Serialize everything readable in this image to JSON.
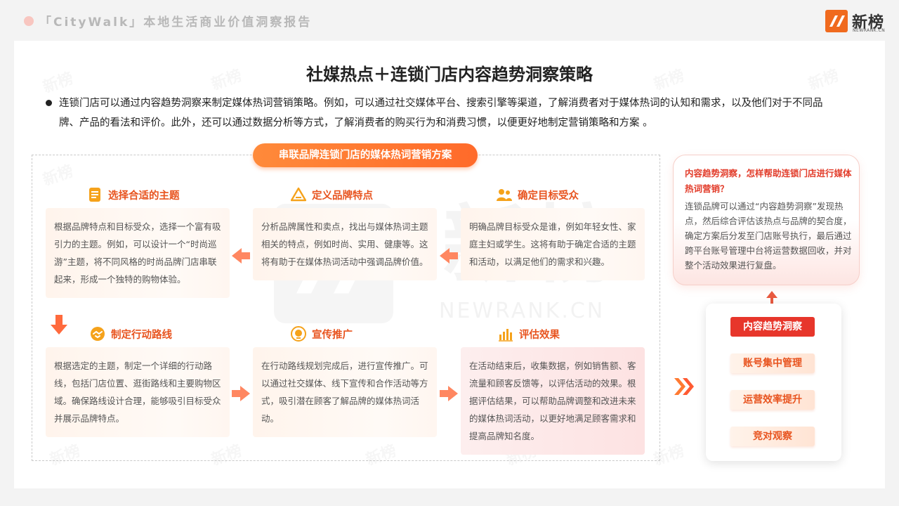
{
  "header": {
    "report_title": "「CityWalk」本地生活商业价值洞察报告",
    "logo_cn": "新榜",
    "logo_en": "NEWRANK.CN"
  },
  "watermark": {
    "cn": "新榜",
    "en": "NEWRANK.CN"
  },
  "page": {
    "title": "社媒热点＋连锁门店内容趋势洞察策略",
    "intro": "连锁门店可以通过内容趋势洞察来制定媒体热词营销策略。例如，可以通过社交媒体平台、搜索引擎等渠道，了解消费者对于媒体热词的认知和需求，以及他们对于不同品牌、产品的看法和评价。此外，还可以通过数据分析等方式，了解消费者的购买行为和消费习惯，以便更好地制定营销策略和方案 。"
  },
  "flow": {
    "title": "串联品牌连锁门店的媒体热词营销方案",
    "steps": [
      {
        "title": "选择合适的主题",
        "text": "根据品牌特点和目标受众，选择一个富有吸引力的主题。例如，可以设计一个“时尚巡游”主题，将不同风格的时尚品牌门店串联起来，形成一个独特的购物体验。"
      },
      {
        "title": "定义品牌特点",
        "text": "分析品牌属性和卖点，找出与媒体热词主题相关的特点，例如时尚、实用、健康等。这将有助于在媒体热词活动中强调品牌价值。"
      },
      {
        "title": "确定目标受众",
        "text": "明确品牌目标受众是谁，例如年轻女性、家庭主妇或学生。这将有助于确定合适的主题和活动，以满足他们的需求和兴趣。"
      },
      {
        "title": "制定行动路线",
        "text": "根据选定的主题，制定一个详细的行动路线，包括门店位置、逛街路线和主要购物区域。确保路线设计合理，能够吸引目标受众并展示品牌特点。"
      },
      {
        "title": "宣传推广",
        "text": "在行动路线规划完成后，进行宣传推广。可以通过社交媒体、线下宣传和合作活动等方式，吸引潜在顾客了解品牌的媒体热词活动。"
      },
      {
        "title": "评估效果",
        "text": "在活动结束后，收集数据，例如销售额、客流量和顾客反馈等，以评估活动的效果。根据评估结果，可以帮助品牌调整和改进未来的媒体热词活动，以更好地满足顾客需求和提高品牌知名度。"
      }
    ]
  },
  "right_panel": {
    "title": "内容趋势洞察，怎样帮助连锁门店进行媒体热词营销？",
    "text": "连锁品牌可以通过“内容趋势洞察”发现热点，然后综合评估该热点与品牌的契合度，确定方案后分发至门店账号执行，最后通过跨平台账号管理中台将运营数据回收，并对整个活动效果进行复盘。",
    "tags": [
      "内容趋势洞察",
      "账号集中管理",
      "运营效率提升",
      "竞对观察"
    ]
  },
  "colors": {
    "accent": "#e8541f",
    "red": "#e7362b",
    "pill": "#ff7a32"
  }
}
